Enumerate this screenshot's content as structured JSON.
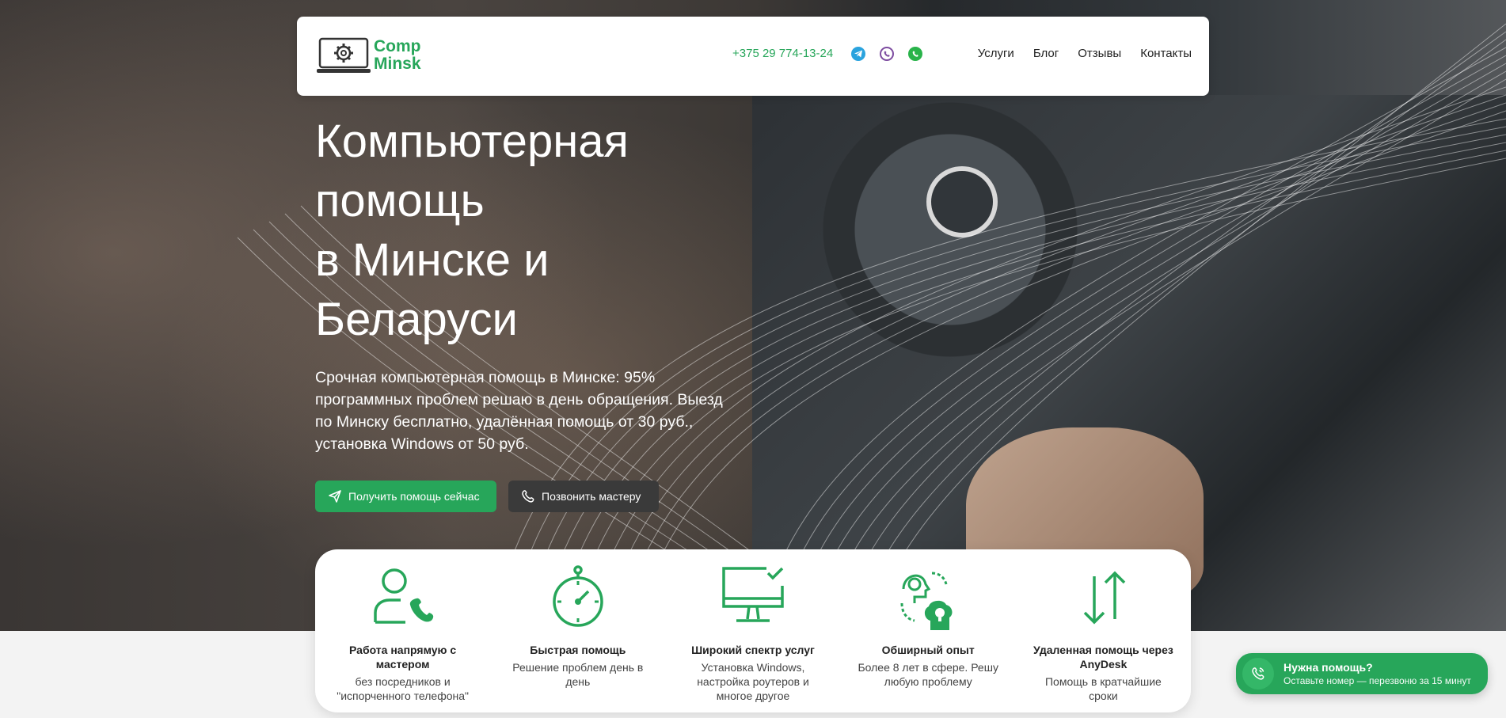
{
  "header": {
    "logo": {
      "line1": "Comp",
      "line2": "Minsk"
    },
    "phone": "+375 29 774-13-24",
    "social": [
      "telegram-icon",
      "viber-icon",
      "whatsapp-icon"
    ],
    "nav": [
      "Услуги",
      "Блог",
      "Отзывы",
      "Контакты"
    ]
  },
  "hero": {
    "title_lines": [
      "Компьютерная",
      "помощь",
      "в Минске и",
      "Беларуси"
    ],
    "subtitle": "Срочная компьютерная помощь в Минске: 95% программных проблем решаю в день обращения. Выезд по Минску бесплатно, удалённая помощь от 30 руб., установка Windows от 50 руб.",
    "primary_button": "Получить помощь сейчас",
    "secondary_button": "Позвонить мастеру"
  },
  "features": [
    {
      "icon": "person-phone-icon",
      "title": "Работа напрямую с мастером",
      "desc": "без посредников и \"испорченного телефона\""
    },
    {
      "icon": "stopwatch-icon",
      "title": "Быстрая помощь",
      "desc": "Решение проблем день в день"
    },
    {
      "icon": "monitor-check-icon",
      "title": "Широкий спектр услуг",
      "desc": "Установка Windows, настройка роутеров и многое другое"
    },
    {
      "icon": "heads-lightbulb-icon",
      "title": "Обширный опыт",
      "desc": "Более 8 лет в сфере. Решу любую проблему"
    },
    {
      "icon": "up-down-arrows-icon",
      "title": "Удаленная помощь через AnyDesk",
      "desc": "Помощь в кратчайшие сроки"
    }
  ],
  "help_popup": {
    "title": "Нужна помощь?",
    "desc": "Оставьте номер — перезвоню за 15 минут"
  },
  "colors": {
    "accent": "#27a65a",
    "dark_button": "#3a3a3a",
    "telegram": "#2aa3de",
    "viber": "#7d4ca0",
    "whatsapp": "#29b34a"
  }
}
